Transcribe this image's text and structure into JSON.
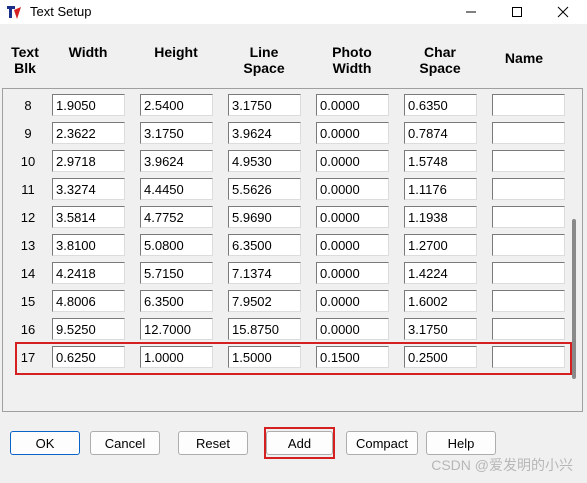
{
  "window": {
    "title": "Text Setup",
    "icon": "text-setup-app-icon"
  },
  "window_controls": {
    "minimize": "—",
    "maximize": "☐",
    "close": "✕"
  },
  "columns": [
    {
      "l1": "Text",
      "l2": "Blk"
    },
    {
      "l1": "Width",
      "l2": ""
    },
    {
      "l1": "Height",
      "l2": ""
    },
    {
      "l1": "Line",
      "l2": "Space"
    },
    {
      "l1": "Photo",
      "l2": "Width"
    },
    {
      "l1": "Char",
      "l2": "Space"
    },
    {
      "l1": "Name",
      "l2": ""
    }
  ],
  "rows": [
    {
      "blk": "8",
      "width": "1.9050",
      "height": "2.5400",
      "line_space": "3.1750",
      "photo_width": "0.0000",
      "char_space": "0.6350",
      "name": ""
    },
    {
      "blk": "9",
      "width": "2.3622",
      "height": "3.1750",
      "line_space": "3.9624",
      "photo_width": "0.0000",
      "char_space": "0.7874",
      "name": ""
    },
    {
      "blk": "10",
      "width": "2.9718",
      "height": "3.9624",
      "line_space": "4.9530",
      "photo_width": "0.0000",
      "char_space": "1.5748",
      "name": ""
    },
    {
      "blk": "11",
      "width": "3.3274",
      "height": "4.4450",
      "line_space": "5.5626",
      "photo_width": "0.0000",
      "char_space": "1.1176",
      "name": ""
    },
    {
      "blk": "12",
      "width": "3.5814",
      "height": "4.7752",
      "line_space": "5.9690",
      "photo_width": "0.0000",
      "char_space": "1.1938",
      "name": ""
    },
    {
      "blk": "13",
      "width": "3.8100",
      "height": "5.0800",
      "line_space": "6.3500",
      "photo_width": "0.0000",
      "char_space": "1.2700",
      "name": ""
    },
    {
      "blk": "14",
      "width": "4.2418",
      "height": "5.7150",
      "line_space": "7.1374",
      "photo_width": "0.0000",
      "char_space": "1.4224",
      "name": ""
    },
    {
      "blk": "15",
      "width": "4.8006",
      "height": "6.3500",
      "line_space": "7.9502",
      "photo_width": "0.0000",
      "char_space": "1.6002",
      "name": ""
    },
    {
      "blk": "16",
      "width": "9.5250",
      "height": "12.7000",
      "line_space": "15.8750",
      "photo_width": "0.0000",
      "char_space": "3.1750",
      "name": ""
    },
    {
      "blk": "17",
      "width": "0.6250",
      "height": "1.0000",
      "line_space": "1.5000",
      "photo_width": "0.1500",
      "char_space": "0.2500",
      "name": ""
    }
  ],
  "buttons": {
    "ok": "OK",
    "cancel": "Cancel",
    "reset": "Reset",
    "add": "Add",
    "compact": "Compact",
    "help": "Help"
  },
  "watermark": "CSDN @爱发明的小兴",
  "colors": {
    "highlight": "#d42020",
    "dialog_bg": "#f0f0f0",
    "default_button_border": "#0a64c8"
  }
}
